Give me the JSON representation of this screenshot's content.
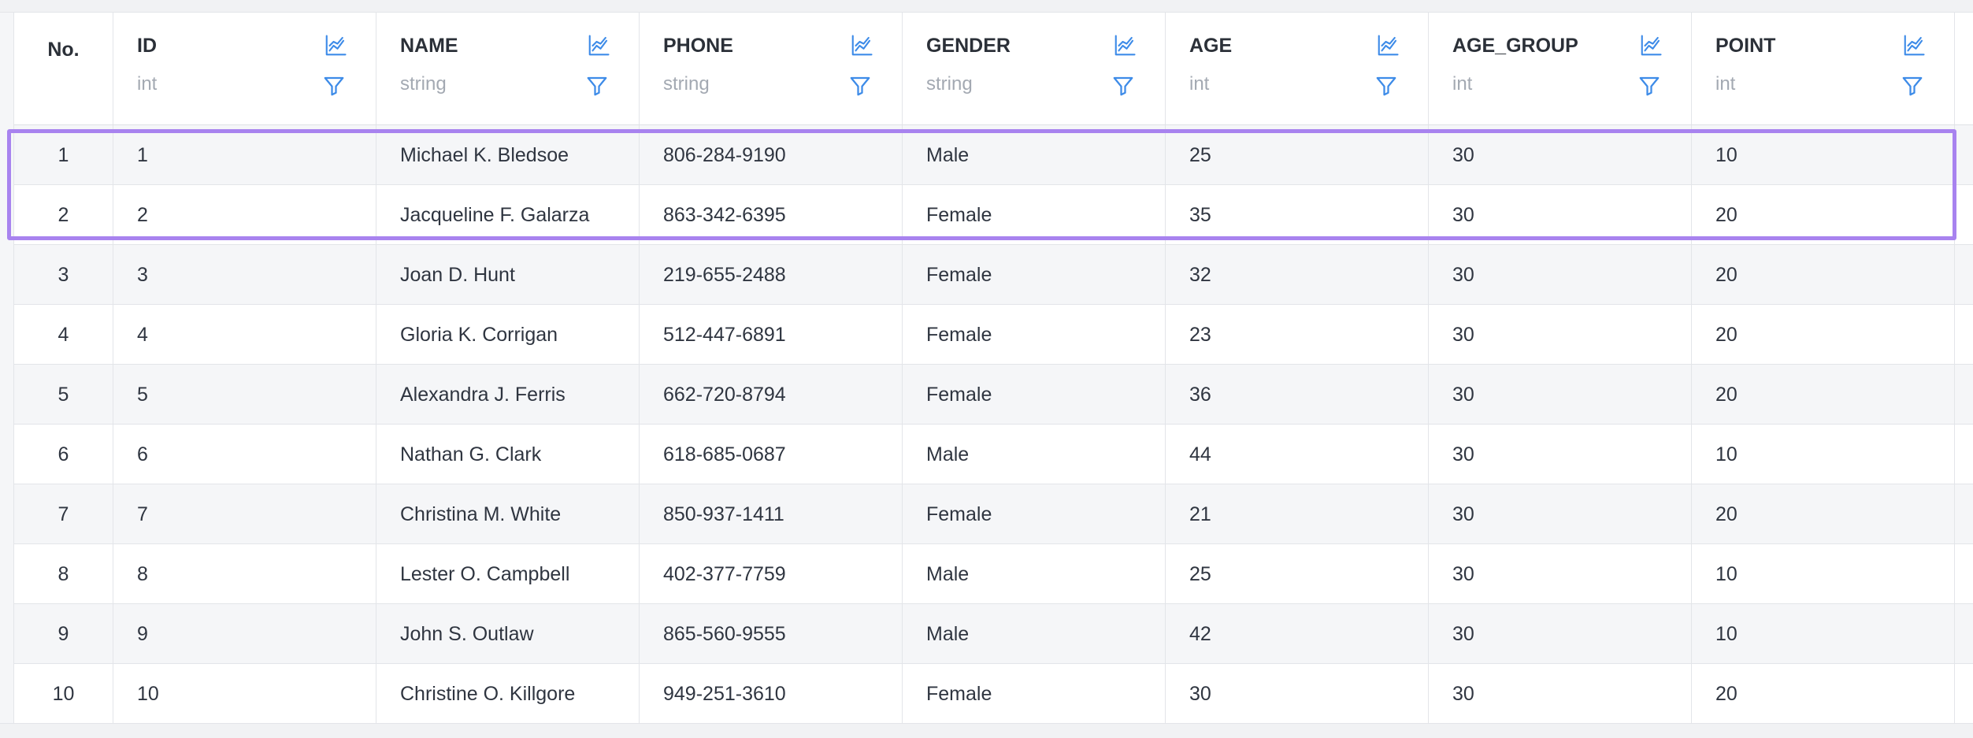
{
  "table": {
    "no_header": "No.",
    "columns": [
      {
        "name": "ID",
        "type": "int"
      },
      {
        "name": "NAME",
        "type": "string"
      },
      {
        "name": "PHONE",
        "type": "string"
      },
      {
        "name": "GENDER",
        "type": "string"
      },
      {
        "name": "AGE",
        "type": "int"
      },
      {
        "name": "AGE_GROUP",
        "type": "int"
      },
      {
        "name": "POINT",
        "type": "int"
      }
    ],
    "rows": [
      {
        "no": "1",
        "cells": [
          "1",
          "Michael K. Bledsoe",
          "806-284-9190",
          "Male",
          "25",
          "30",
          "10"
        ]
      },
      {
        "no": "2",
        "cells": [
          "2",
          "Jacqueline F. Galarza",
          "863-342-6395",
          "Female",
          "35",
          "30",
          "20"
        ]
      },
      {
        "no": "3",
        "cells": [
          "3",
          "Joan D. Hunt",
          "219-655-2488",
          "Female",
          "32",
          "30",
          "20"
        ]
      },
      {
        "no": "4",
        "cells": [
          "4",
          "Gloria K. Corrigan",
          "512-447-6891",
          "Female",
          "23",
          "30",
          "20"
        ]
      },
      {
        "no": "5",
        "cells": [
          "5",
          "Alexandra J. Ferris",
          "662-720-8794",
          "Female",
          "36",
          "30",
          "20"
        ]
      },
      {
        "no": "6",
        "cells": [
          "6",
          "Nathan G. Clark",
          "618-685-0687",
          "Male",
          "44",
          "30",
          "10"
        ]
      },
      {
        "no": "7",
        "cells": [
          "7",
          "Christina M. White",
          "850-937-1411",
          "Female",
          "21",
          "30",
          "20"
        ]
      },
      {
        "no": "8",
        "cells": [
          "8",
          "Lester O. Campbell",
          "402-377-7759",
          "Male",
          "25",
          "30",
          "10"
        ]
      },
      {
        "no": "9",
        "cells": [
          "9",
          "John S. Outlaw",
          "865-560-9555",
          "Male",
          "42",
          "30",
          "10"
        ]
      },
      {
        "no": "10",
        "cells": [
          "10",
          "Christine O. Killgore",
          "949-251-3610",
          "Female",
          "30",
          "30",
          "20"
        ]
      }
    ],
    "selected_rows": [
      "1",
      "2"
    ]
  },
  "icons": {
    "column_chart": "chart-icon",
    "column_filter": "filter-icon"
  },
  "colors": {
    "accent": "#3d8be8",
    "selection": "#a883ef",
    "row_alt": "#f5f6f8"
  }
}
